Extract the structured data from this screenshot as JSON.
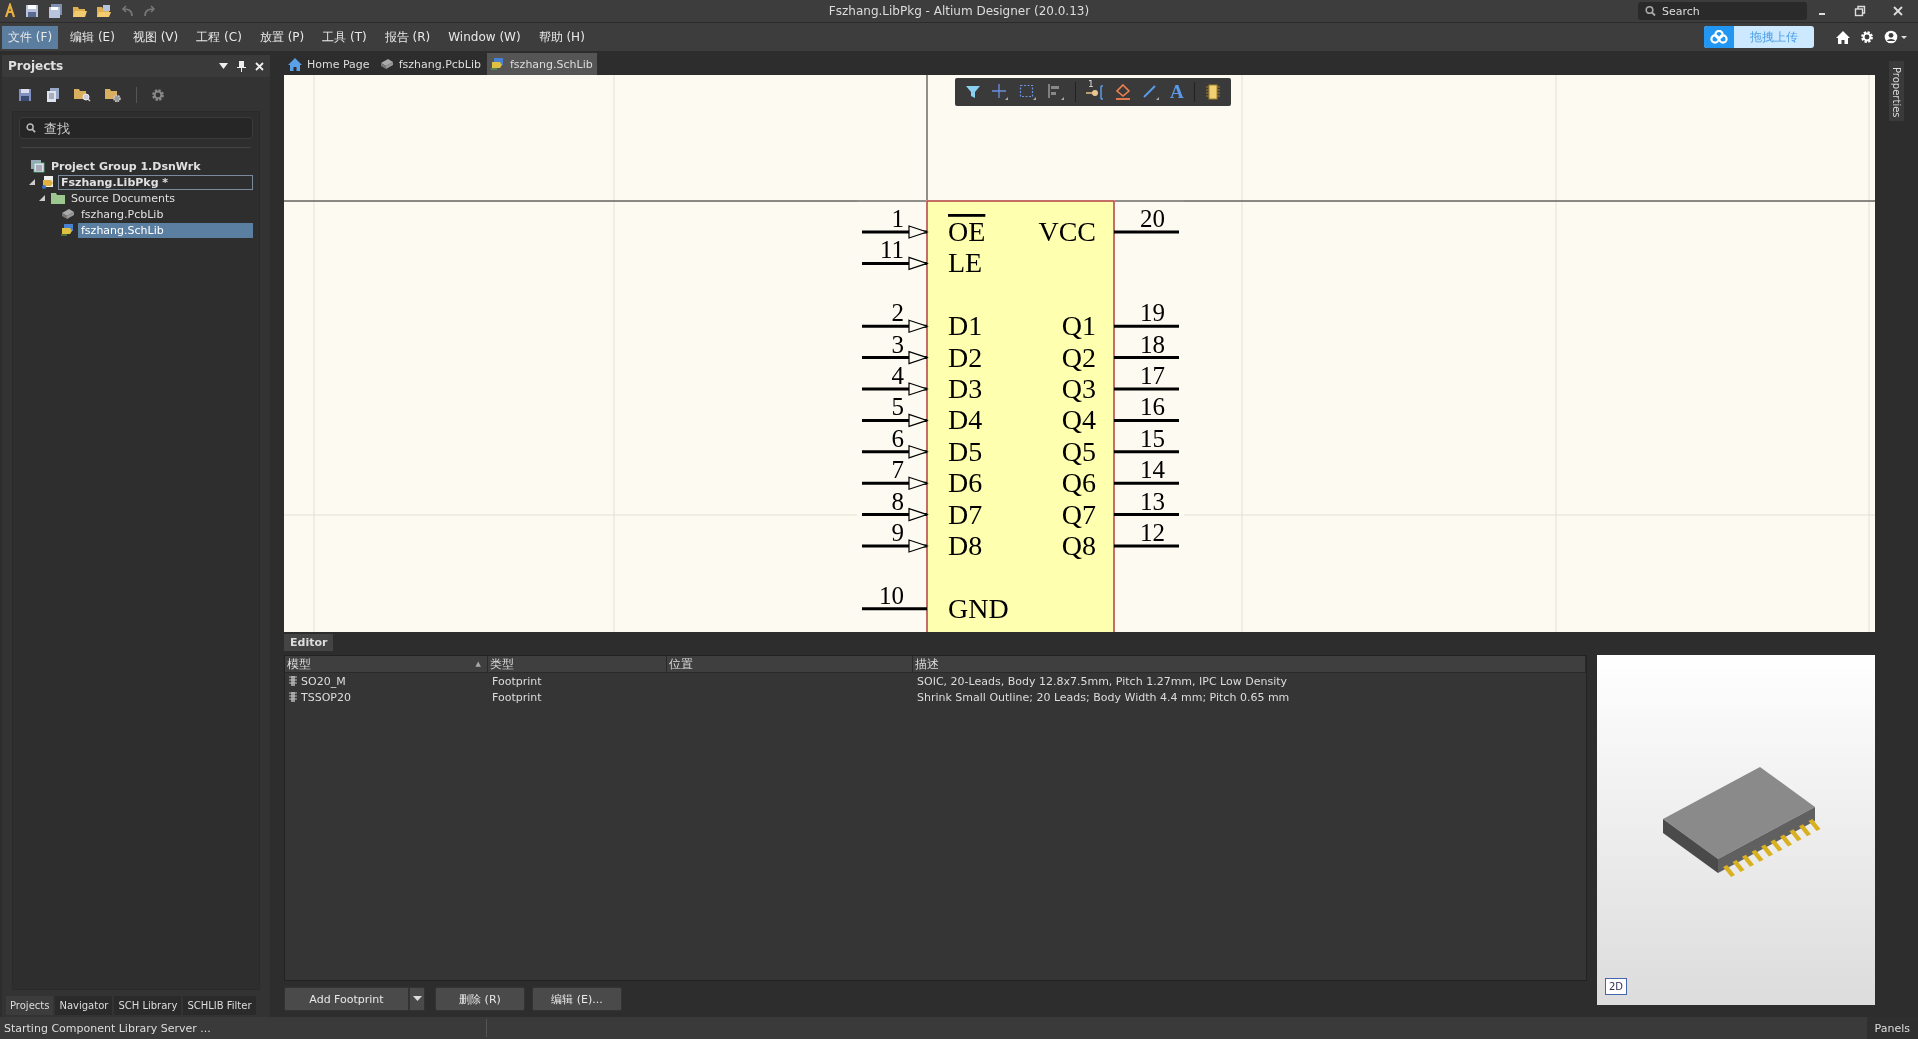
{
  "window": {
    "title": "Fszhang.LibPkg - Altium Designer (20.0.13)",
    "search_placeholder": "Search"
  },
  "menu": [
    {
      "label": "文件 (F)",
      "selected": true
    },
    {
      "label": "编辑 (E)",
      "selected": false
    },
    {
      "label": "视图 (V)",
      "selected": false
    },
    {
      "label": "工程 (C)",
      "selected": false
    },
    {
      "label": "放置 (P)",
      "selected": false
    },
    {
      "label": "工具 (T)",
      "selected": false
    },
    {
      "label": "报告 (R)",
      "selected": false
    },
    {
      "label": "Window (W)",
      "selected": false
    },
    {
      "label": "帮助 (H)",
      "selected": false
    }
  ],
  "upload_button": {
    "label": "拖拽上传"
  },
  "projects_panel": {
    "title": "Projects",
    "search": {
      "placeholder": "查找"
    },
    "tree": [
      {
        "label": "Project Group 1.DsnWrk",
        "kind": "workspace",
        "selected": false,
        "focused": false,
        "children": [
          {
            "label": "Fszhang.LibPkg *",
            "kind": "package",
            "selected": false,
            "focused": true,
            "expanded": true,
            "children": [
              {
                "label": "Source Documents",
                "kind": "folder",
                "selected": false,
                "focused": false,
                "expanded": true,
                "children": [
                  {
                    "label": "fszhang.PcbLib",
                    "kind": "pcblib",
                    "selected": false,
                    "focused": false
                  },
                  {
                    "label": "fszhang.SchLib",
                    "kind": "schlib",
                    "selected": true,
                    "focused": false
                  }
                ]
              }
            ]
          }
        ]
      }
    ],
    "tabs": [
      {
        "label": "Projects",
        "selected": true
      },
      {
        "label": "Navigator",
        "selected": false
      },
      {
        "label": "SCH Library",
        "selected": false
      },
      {
        "label": "SCHLIB Filter",
        "selected": false
      }
    ]
  },
  "document_tabs": [
    {
      "label": "Home Page",
      "kind": "home",
      "selected": false
    },
    {
      "label": "fszhang.PcbLib",
      "kind": "pcblib",
      "selected": false
    },
    {
      "label": "fszhang.SchLib",
      "kind": "schlib",
      "selected": true
    }
  ],
  "toolbar": [
    {
      "kind": "filter"
    },
    {
      "kind": "move"
    },
    {
      "kind": "select"
    },
    {
      "kind": "align"
    },
    {
      "kind": "pin",
      "glyph": "1"
    },
    {
      "kind": "shape"
    },
    {
      "kind": "line"
    },
    {
      "kind": "text",
      "glyph": "A"
    },
    {
      "kind": "part"
    }
  ],
  "component": {
    "pin_rows": [
      {
        "left": {
          "number": "1",
          "name": "OE",
          "negated": true,
          "kind": "input"
        },
        "right": {
          "number": "20",
          "name": "VCC",
          "negated": false,
          "kind": "passive"
        }
      },
      {
        "left": {
          "number": "11",
          "name": "LE",
          "negated": false,
          "kind": "input"
        }
      },
      null,
      {
        "left": {
          "number": "2",
          "name": "D1",
          "negated": false,
          "kind": "input"
        },
        "right": {
          "number": "19",
          "name": "Q1",
          "negated": false,
          "kind": "passive"
        }
      },
      {
        "left": {
          "number": "3",
          "name": "D2",
          "negated": false,
          "kind": "input"
        },
        "right": {
          "number": "18",
          "name": "Q2",
          "negated": false,
          "kind": "passive"
        }
      },
      {
        "left": {
          "number": "4",
          "name": "D3",
          "negated": false,
          "kind": "input"
        },
        "right": {
          "number": "17",
          "name": "Q3",
          "negated": false,
          "kind": "passive"
        }
      },
      {
        "left": {
          "number": "5",
          "name": "D4",
          "negated": false,
          "kind": "input"
        },
        "right": {
          "number": "16",
          "name": "Q4",
          "negated": false,
          "kind": "passive"
        }
      },
      {
        "left": {
          "number": "6",
          "name": "D5",
          "negated": false,
          "kind": "input"
        },
        "right": {
          "number": "15",
          "name": "Q5",
          "negated": false,
          "kind": "passive"
        }
      },
      {
        "left": {
          "number": "7",
          "name": "D6",
          "negated": false,
          "kind": "input"
        },
        "right": {
          "number": "14",
          "name": "Q6",
          "negated": false,
          "kind": "passive"
        }
      },
      {
        "left": {
          "number": "8",
          "name": "D7",
          "negated": false,
          "kind": "input"
        },
        "right": {
          "number": "13",
          "name": "Q7",
          "negated": false,
          "kind": "passive"
        }
      },
      {
        "left": {
          "number": "9",
          "name": "D8",
          "negated": false,
          "kind": "input"
        },
        "right": {
          "number": "12",
          "name": "Q8",
          "negated": false,
          "kind": "passive"
        }
      },
      null,
      {
        "left": {
          "number": "10",
          "name": "GND",
          "negated": false,
          "kind": "passive"
        }
      }
    ]
  },
  "editor": {
    "title": "Editor",
    "columns": [
      {
        "label": "模型",
        "sort": "▲"
      },
      {
        "label": "类型"
      },
      {
        "label": "位置"
      },
      {
        "label": "描述"
      }
    ],
    "rows": [
      {
        "model": "SO20_M",
        "type": "Footprint",
        "description": "SOIC, 20-Leads, Body 12.8x7.5mm, Pitch 1.27mm, IPC Low Density"
      },
      {
        "model": "TSSOP20",
        "type": "Footprint",
        "description": "Shrink Small Outline; 20 Leads; Body Width 4.4 mm; Pitch 0.65 mm"
      }
    ],
    "view_toggle": "2D",
    "buttons": [
      "Add Footprint",
      "删除 (R)",
      "编辑 (E)..."
    ]
  },
  "right_panel_tab": "Properties",
  "status_bar": {
    "message": "Starting Component Library Server ...",
    "panels_button": "Panels"
  }
}
